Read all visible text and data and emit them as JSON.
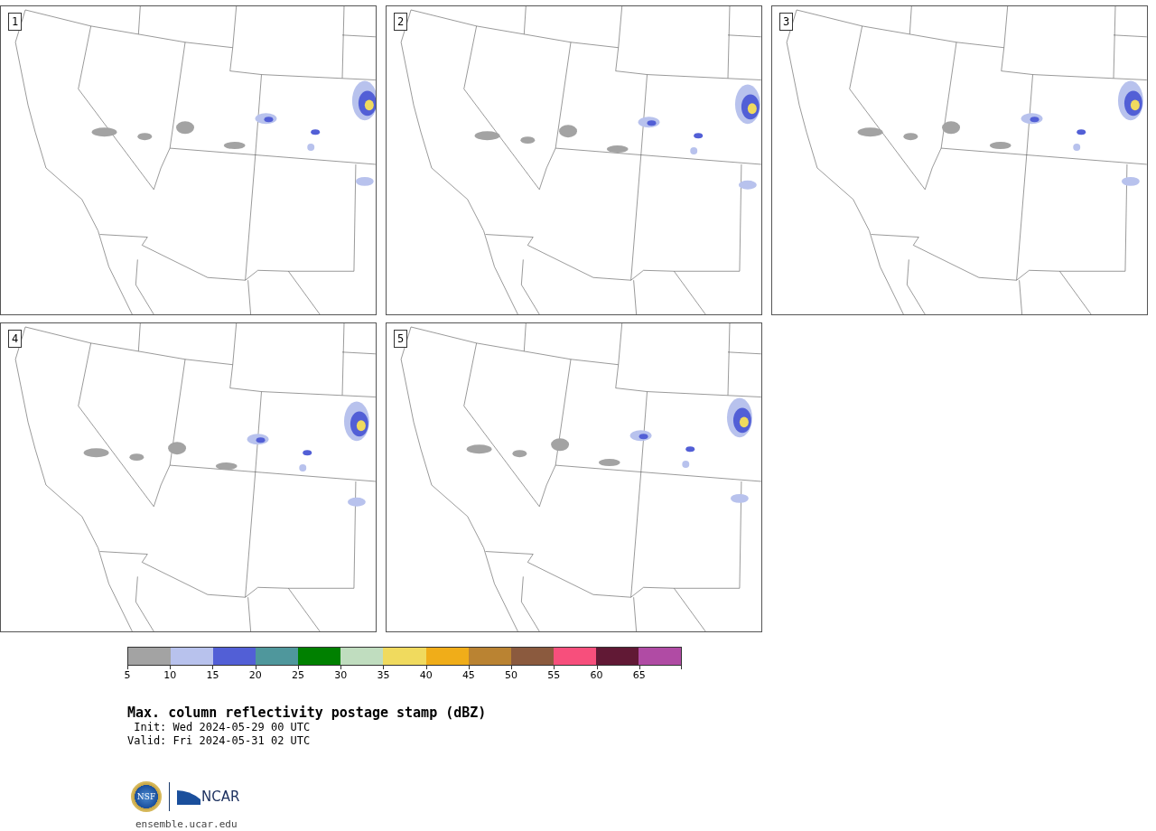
{
  "panels": [
    {
      "label": "1"
    },
    {
      "label": "2"
    },
    {
      "label": "3"
    },
    {
      "label": "4"
    },
    {
      "label": "5"
    }
  ],
  "colorbar": [
    {
      "color": "#a3a3a3",
      "tick": "5"
    },
    {
      "color": "#b8c2ed",
      "tick": "10"
    },
    {
      "color": "#525fd6",
      "tick": "15"
    },
    {
      "color": "#4f979c",
      "tick": "20"
    },
    {
      "color": "#008000",
      "tick": "25"
    },
    {
      "color": "#c0ddbf",
      "tick": "30"
    },
    {
      "color": "#f0da5e",
      "tick": "35"
    },
    {
      "color": "#f0ad19",
      "tick": "40"
    },
    {
      "color": "#ba8332",
      "tick": "45"
    },
    {
      "color": "#8b5a3e",
      "tick": "50"
    },
    {
      "color": "#f74f7c",
      "tick": "55"
    },
    {
      "color": "#611935",
      "tick": "60"
    },
    {
      "color": "#b04ba4",
      "tick": "65"
    }
  ],
  "title": "Max. column reflectivity postage stamp (dBZ)",
  "init": " Init: Wed 2024-05-29 00 UTC",
  "valid": "Valid: Fri 2024-05-31 02 UTC",
  "logo": {
    "seal": "NSF",
    "name": "NCAR"
  },
  "url": "ensemble.ucar.edu"
}
